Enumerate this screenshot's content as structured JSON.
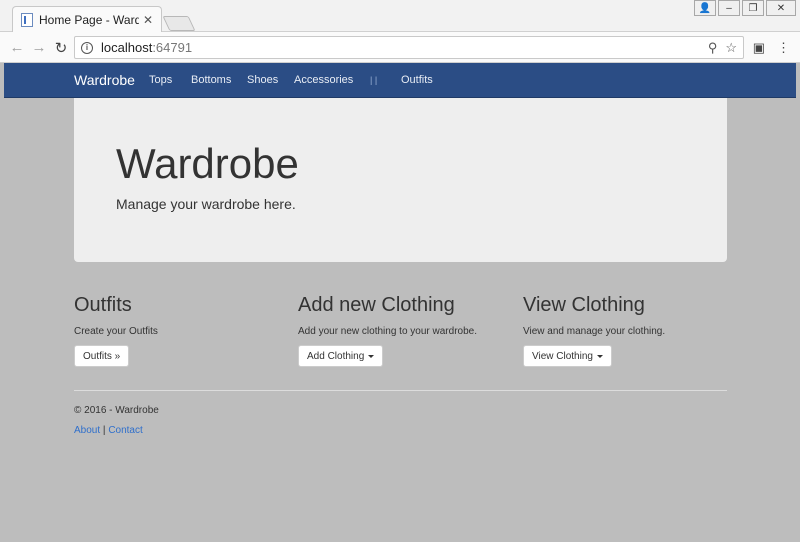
{
  "browser": {
    "tab_title": "Home Page - Wardrobe",
    "url_host": "localhost",
    "url_port": ":64791"
  },
  "navbar": {
    "brand": "Wardrobe",
    "links": [
      "Tops",
      "Bottoms",
      "Shoes",
      "Accessories"
    ],
    "separator": "| |",
    "outfits_link": "Outfits"
  },
  "jumbotron": {
    "title": "Wardrobe",
    "lead": "Manage your wardrobe here."
  },
  "columns": [
    {
      "heading": "Outfits",
      "text": "Create your Outfits",
      "button": "Outfits »"
    },
    {
      "heading": "Add new Clothing",
      "text": "Add your new clothing to your wardrobe.",
      "button": "Add Clothing"
    },
    {
      "heading": "View Clothing",
      "text": "View and manage your clothing.",
      "button": "View Clothing"
    }
  ],
  "footer": {
    "copyright": "© 2016 - Wardrobe",
    "about": "About",
    "pipe": "|",
    "contact": "Contact"
  }
}
